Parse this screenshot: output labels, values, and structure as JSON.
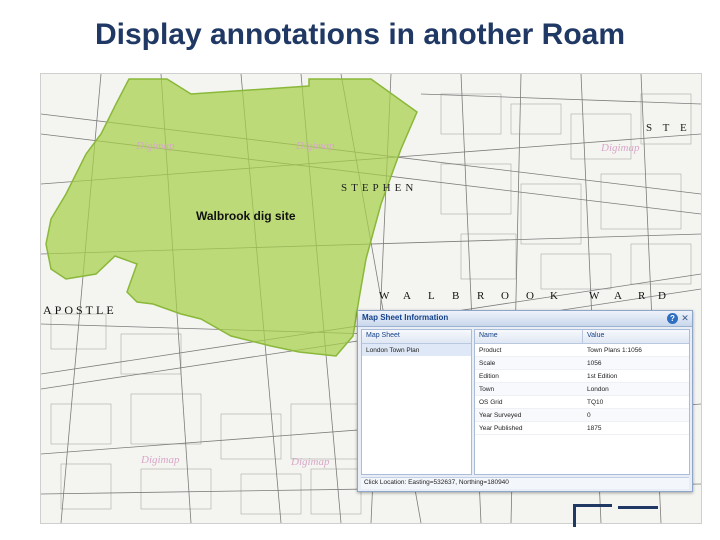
{
  "slide": {
    "title": "Display annotations in another Roam"
  },
  "map": {
    "annotation_label": "Walbrook dig site",
    "annotation_fill": "#a6d04a",
    "annotation_stroke": "#8ab83a",
    "ward_label": [
      "W",
      "A",
      "L",
      "B",
      "R",
      "O",
      "O",
      "K",
      "W",
      "A",
      "R",
      "D"
    ],
    "street_apostle": "APOSTLE",
    "street_stephen": "STEPHEN",
    "street_ste": "S T E",
    "watermark": "Digimap"
  },
  "panel": {
    "title": "Map Sheet Information",
    "help_icon": "?",
    "close_icon": "✕",
    "left_header": "Map Sheet",
    "map_sheets": [
      "London Town Plan"
    ],
    "columns": [
      "Name",
      "Value"
    ],
    "rows": [
      {
        "name": "Product",
        "value": "Town Plans 1:1056"
      },
      {
        "name": "Scale",
        "value": "1056"
      },
      {
        "name": "Edition",
        "value": "1st Edition"
      },
      {
        "name": "Town",
        "value": "London"
      },
      {
        "name": "OS Grid",
        "value": "TQ10"
      },
      {
        "name": "Year Surveyed",
        "value": "0"
      },
      {
        "name": "Year Published",
        "value": "1875"
      }
    ],
    "status": "Click Location: Easting=532637, Northing=180940"
  }
}
